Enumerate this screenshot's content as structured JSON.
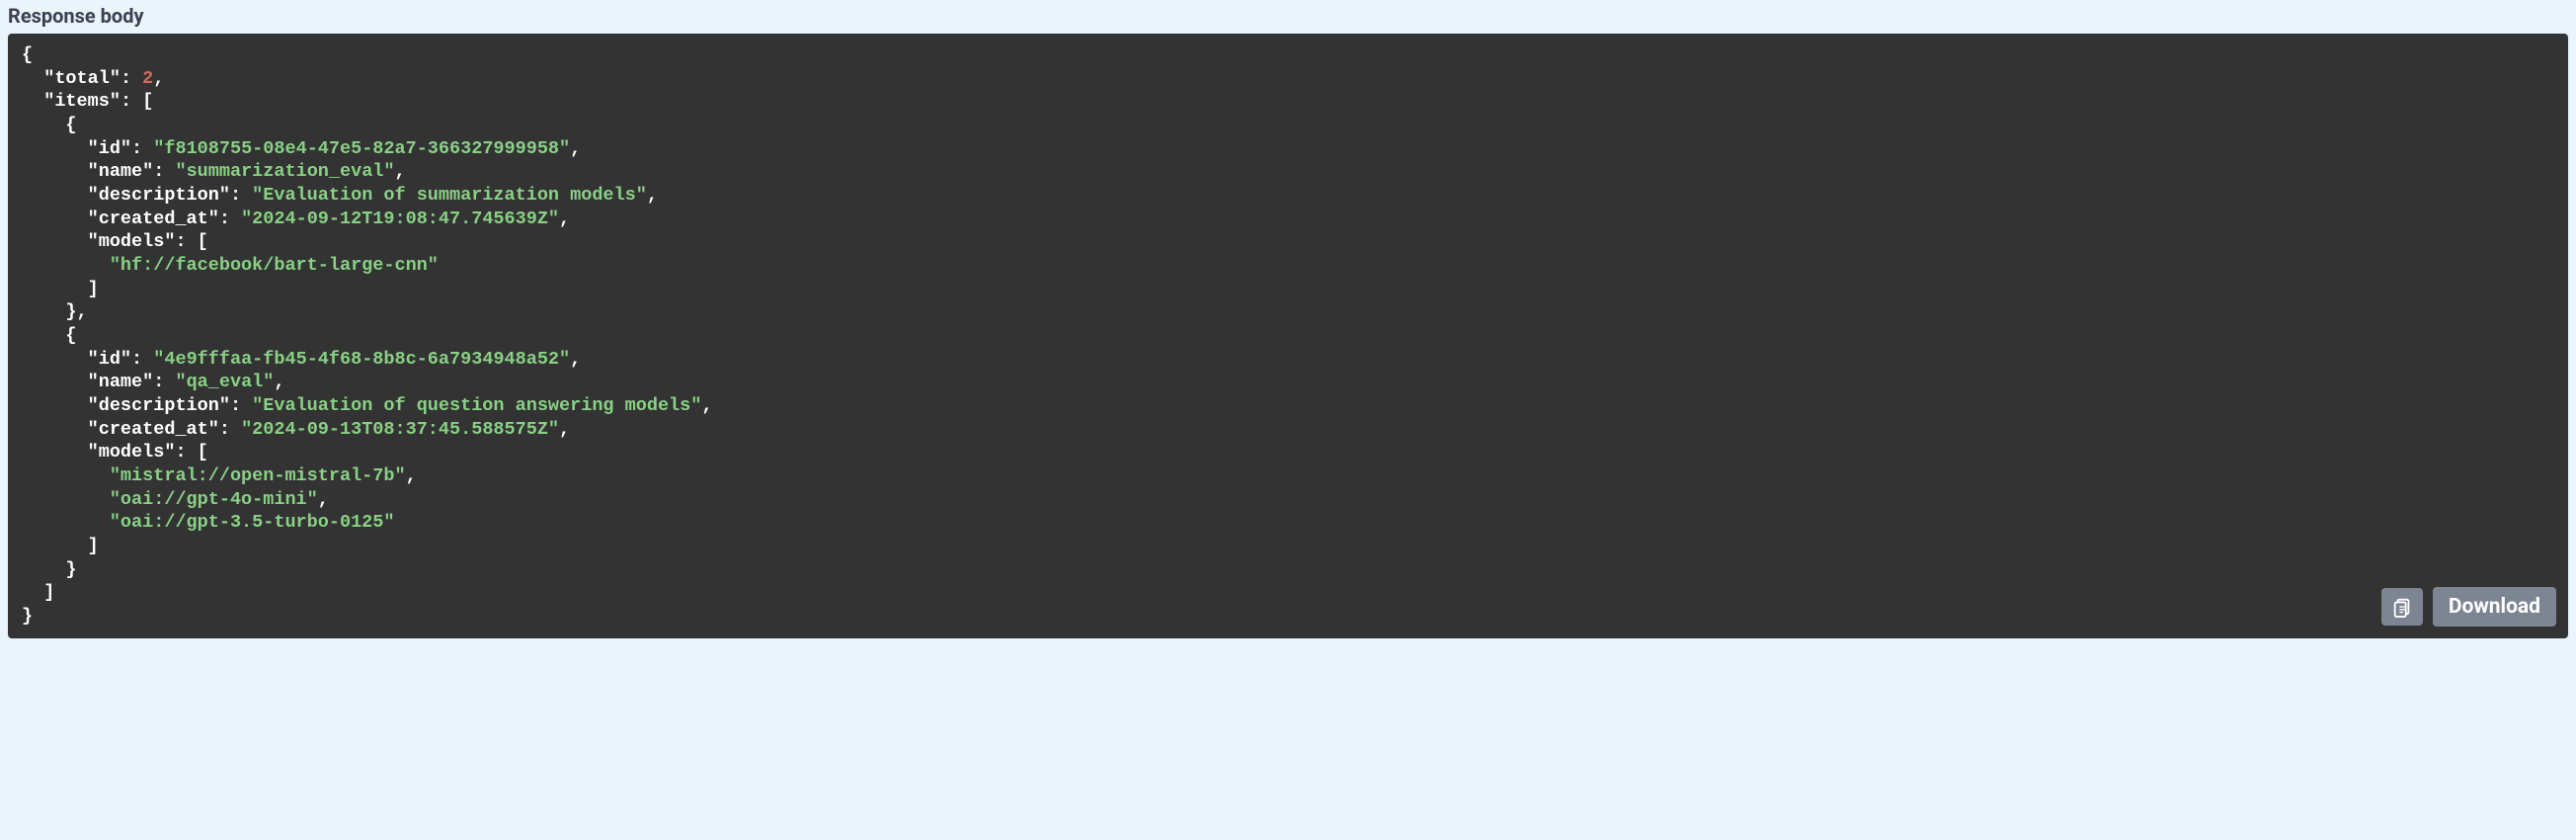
{
  "header": {
    "title": "Response body"
  },
  "json": {
    "total_key": "\"total\"",
    "total_value": "2",
    "items_key": "\"items\"",
    "item0": {
      "id_key": "\"id\"",
      "id_value": "\"f8108755-08e4-47e5-82a7-366327999958\"",
      "name_key": "\"name\"",
      "name_value": "\"summarization_eval\"",
      "description_key": "\"description\"",
      "description_value": "\"Evaluation of summarization models\"",
      "created_at_key": "\"created_at\"",
      "created_at_value": "\"2024-09-12T19:08:47.745639Z\"",
      "models_key": "\"models\"",
      "model0": "\"hf://facebook/bart-large-cnn\""
    },
    "item1": {
      "id_key": "\"id\"",
      "id_value": "\"4e9fffaa-fb45-4f68-8b8c-6a7934948a52\"",
      "name_key": "\"name\"",
      "name_value": "\"qa_eval\"",
      "description_key": "\"description\"",
      "description_value": "\"Evaluation of question answering models\"",
      "created_at_key": "\"created_at\"",
      "created_at_value": "\"2024-09-13T08:37:45.588575Z\"",
      "models_key": "\"models\"",
      "model0": "\"mistral://open-mistral-7b\"",
      "model1": "\"oai://gpt-4o-mini\"",
      "model2": "\"oai://gpt-3.5-turbo-0125\""
    }
  },
  "actions": {
    "download_label": "Download"
  }
}
